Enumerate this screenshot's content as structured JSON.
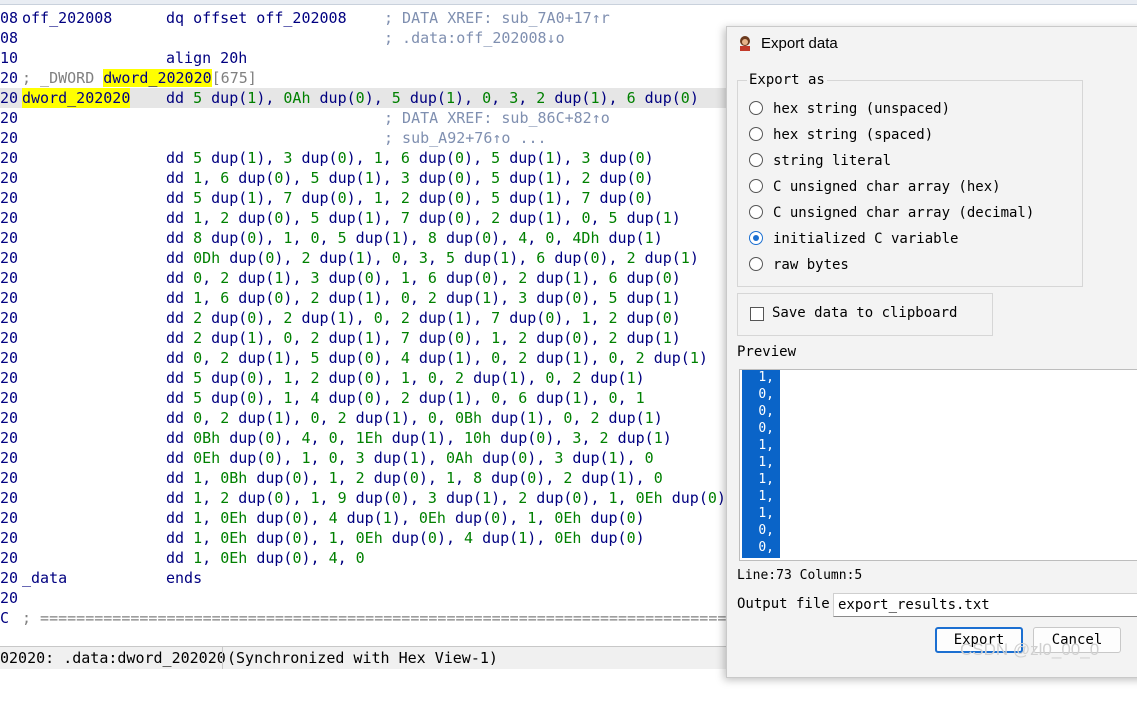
{
  "listing": {
    "rows": [
      {
        "addr": "08",
        "label": "off_202008",
        "instr": "dq offset off_202008",
        "comment": "; DATA XREF: sub_7A0+17↑r"
      },
      {
        "addr": "08",
        "label": "",
        "instr": "",
        "comment": "; .data:off_202008↓o"
      },
      {
        "addr": "10",
        "label": "",
        "instr": "align 20h",
        "comment": ""
      },
      {
        "addr": "20",
        "label": "; _DWORD ",
        "label_hl": "dword_202020",
        "label_tail": "[675]",
        "instr": "",
        "comment": ""
      },
      {
        "addr": "20",
        "label": "dword_202020",
        "instr": "dd 5 dup(1), 0Ah dup(0), 5 dup(1), 0, 3, 2 dup(1), 6 dup(0)",
        "comment": "",
        "selected": true
      },
      {
        "addr": "20",
        "label": "",
        "instr": "",
        "comment": "; DATA XREF: sub_86C+82↑o"
      },
      {
        "addr": "20",
        "label": "",
        "instr": "",
        "comment": "; sub_A92+76↑o ..."
      },
      {
        "addr": "20",
        "label": "",
        "instr": "dd 5 dup(1), 3 dup(0), 1, 6 dup(0), 5 dup(1), 3 dup(0)",
        "comment": ""
      },
      {
        "addr": "20",
        "label": "",
        "instr": "dd 1, 6 dup(0), 5 dup(1), 3 dup(0), 5 dup(1), 2 dup(0)",
        "comment": ""
      },
      {
        "addr": "20",
        "label": "",
        "instr": "dd 5 dup(1), 7 dup(0), 1, 2 dup(0), 5 dup(1), 7 dup(0)",
        "comment": ""
      },
      {
        "addr": "20",
        "label": "",
        "instr": "dd 1, 2 dup(0), 5 dup(1), 7 dup(0), 2 dup(1), 0, 5 dup(1)",
        "comment": ""
      },
      {
        "addr": "20",
        "label": "",
        "instr": "dd 8 dup(0), 1, 0, 5 dup(1), 8 dup(0), 4, 0, 4Dh dup(1)",
        "comment": ""
      },
      {
        "addr": "20",
        "label": "",
        "instr": "dd 0Dh dup(0), 2 dup(1), 0, 3, 5 dup(1), 6 dup(0), 2 dup(1)",
        "comment": ""
      },
      {
        "addr": "20",
        "label": "",
        "instr": "dd 0, 2 dup(1), 3 dup(0), 1, 6 dup(0), 2 dup(1), 6 dup(0)",
        "comment": ""
      },
      {
        "addr": "20",
        "label": "",
        "instr": "dd 1, 6 dup(0), 2 dup(1), 0, 2 dup(1), 3 dup(0), 5 dup(1)",
        "comment": ""
      },
      {
        "addr": "20",
        "label": "",
        "instr": "dd 2 dup(0), 2 dup(1), 0, 2 dup(1), 7 dup(0), 1, 2 dup(0)",
        "comment": ""
      },
      {
        "addr": "20",
        "label": "",
        "instr": "dd 2 dup(1), 0, 2 dup(1), 7 dup(0), 1, 2 dup(0), 2 dup(1)",
        "comment": ""
      },
      {
        "addr": "20",
        "label": "",
        "instr": "dd 0, 2 dup(1), 5 dup(0), 4 dup(1), 0, 2 dup(1), 0, 2 dup(1)",
        "comment": ""
      },
      {
        "addr": "20",
        "label": "",
        "instr": "dd 5 dup(0), 1, 2 dup(0), 1, 0, 2 dup(1), 0, 2 dup(1)",
        "comment": ""
      },
      {
        "addr": "20",
        "label": "",
        "instr": "dd 5 dup(0), 1, 4 dup(0), 2 dup(1), 0, 6 dup(1), 0, 1",
        "comment": ""
      },
      {
        "addr": "20",
        "label": "",
        "instr": "dd 0, 2 dup(1), 0, 2 dup(1), 0, 0Bh dup(1), 0, 2 dup(1)",
        "comment": ""
      },
      {
        "addr": "20",
        "label": "",
        "instr": "dd 0Bh dup(0), 4, 0, 1Eh dup(1), 10h dup(0), 3, 2 dup(1)",
        "comment": ""
      },
      {
        "addr": "20",
        "label": "",
        "instr": "dd 0Eh dup(0), 1, 0, 3 dup(1), 0Ah dup(0), 3 dup(1), 0",
        "comment": ""
      },
      {
        "addr": "20",
        "label": "",
        "instr": "dd 1, 0Bh dup(0), 1, 2 dup(0), 1, 8 dup(0), 2 dup(1), 0",
        "comment": ""
      },
      {
        "addr": "20",
        "label": "",
        "instr": "dd 1, 2 dup(0), 1, 9 dup(0), 3 dup(1), 2 dup(0), 1, 0Eh dup(0)",
        "comment": ""
      },
      {
        "addr": "20",
        "label": "",
        "instr": "dd 1, 0Eh dup(0), 4 dup(1), 0Eh dup(0), 1, 0Eh dup(0)",
        "comment": ""
      },
      {
        "addr": "20",
        "label": "",
        "instr": "dd 1, 0Eh dup(0), 1, 0Eh dup(0), 4 dup(1), 0Eh dup(0)",
        "comment": ""
      },
      {
        "addr": "20",
        "label": "",
        "instr": "dd 1, 0Eh dup(0), 4, 0",
        "comment": ""
      },
      {
        "addr": "20",
        "label": "_data",
        "instr": "ends",
        "comment": ""
      },
      {
        "addr": "20",
        "label": "",
        "instr": "",
        "comment": ""
      },
      {
        "addr": "C",
        "label": "; ==================================================================================",
        "instr": "",
        "comment": ""
      }
    ],
    "statusbar": {
      "left": "02020: .data:dword_202020",
      "right": "(Synchronized with Hex View-1)"
    }
  },
  "dialog": {
    "title": "Export data",
    "group_title": "Export as",
    "options": [
      {
        "label": "hex string (unspaced)",
        "selected": false
      },
      {
        "label": "hex string (spaced)",
        "selected": false
      },
      {
        "label": "string literal",
        "selected": false
      },
      {
        "label": "C unsigned char array (hex)",
        "selected": false
      },
      {
        "label": "C unsigned char array (decimal)",
        "selected": false
      },
      {
        "label": "initialized C variable",
        "selected": true
      },
      {
        "label": "raw bytes",
        "selected": false
      }
    ],
    "clipboard_label": "Save data to clipboard",
    "clipboard_checked": false,
    "preview_label": "Preview",
    "preview_lines": [
      "1,",
      "0,",
      "0,",
      "0,",
      "1,",
      "1,",
      "1,",
      "1,",
      "1,",
      "0,",
      "0,"
    ],
    "linecol": "Line:73 Column:5",
    "output_label": "Output file",
    "output_value": "export_results.txt",
    "export_button": "Export",
    "cancel_button": "Cancel"
  },
  "watermark": "CSDN @zl0_00_0"
}
